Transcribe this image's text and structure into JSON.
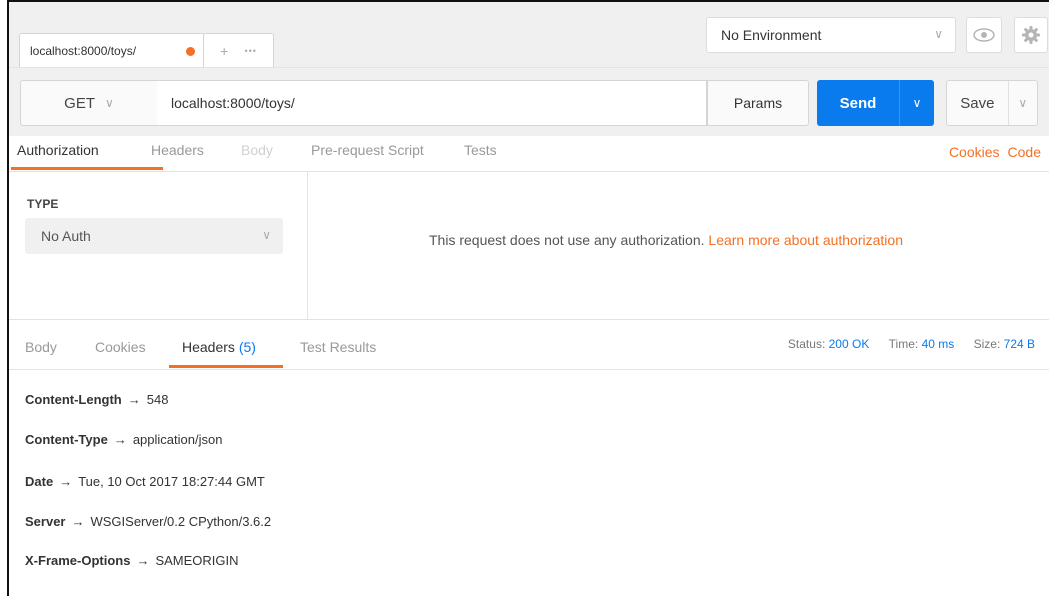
{
  "tab": {
    "label": "localhost:8000/toys/"
  },
  "new_tab": {
    "plus": "+",
    "more": "•••"
  },
  "environment": {
    "selected": "No Environment"
  },
  "request": {
    "method": "GET",
    "url": "localhost:8000/toys/",
    "params_label": "Params",
    "send_label": "Send",
    "save_label": "Save"
  },
  "request_tabs": [
    "Authorization",
    "Headers",
    "Body",
    "Pre-request Script",
    "Tests"
  ],
  "request_links": {
    "cookies": "Cookies",
    "code": "Code"
  },
  "auth": {
    "type_label": "TYPE",
    "type_value": "No Auth",
    "message": "This request does not use any authorization.",
    "learn_more": "Learn more about authorization"
  },
  "response_tabs": {
    "body": "Body",
    "cookies": "Cookies",
    "headers": "Headers",
    "headers_count": "(5)",
    "tests": "Test Results"
  },
  "response_status": {
    "status_label": "Status:",
    "status_value": "200 OK",
    "time_label": "Time:",
    "time_value": "40 ms",
    "size_label": "Size:",
    "size_value": "724 B"
  },
  "response_headers": [
    {
      "key": "Content-Length",
      "arrow": "→",
      "value": "548"
    },
    {
      "key": "Content-Type",
      "arrow": "→",
      "value": "application/json"
    },
    {
      "key": "Date",
      "arrow": "→",
      "value": "Tue, 10 Oct 2017 18:27:44 GMT"
    },
    {
      "key": "Server",
      "arrow": "→",
      "value": "WSGIServer/0.2 CPython/3.6.2"
    },
    {
      "key": "X-Frame-Options",
      "arrow": "→",
      "value": "SAMEORIGIN"
    }
  ],
  "colors": {
    "accent": "#f47023",
    "primary": "#097bed"
  }
}
